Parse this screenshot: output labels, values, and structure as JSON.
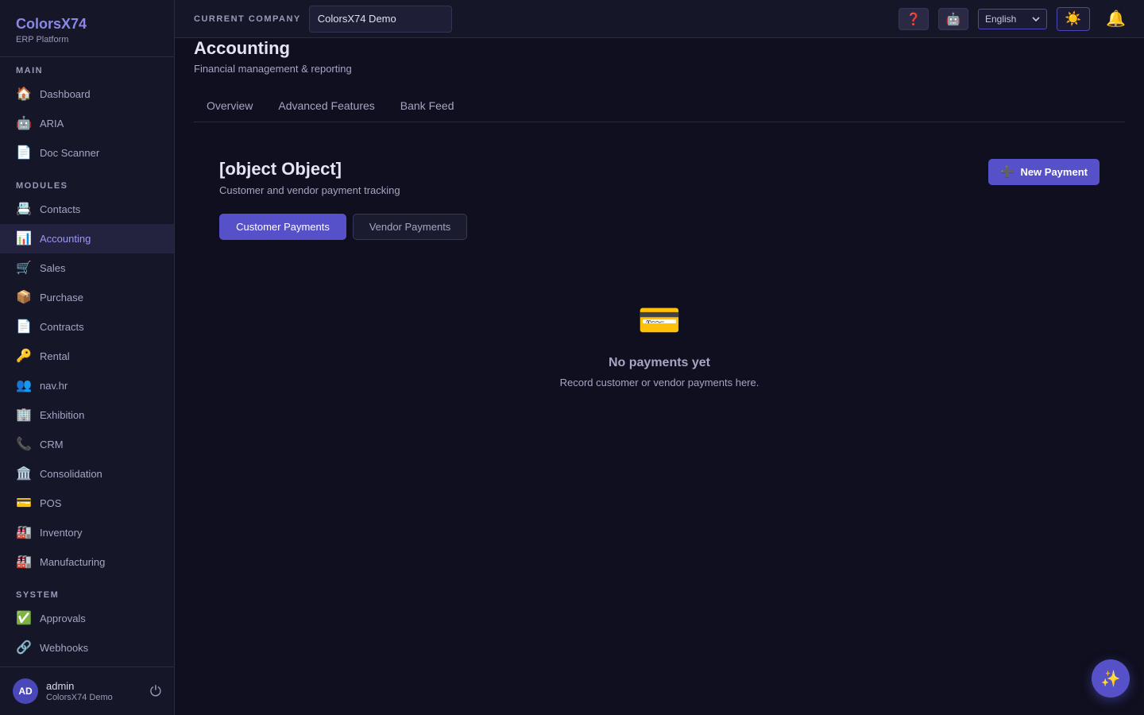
{
  "brand": {
    "name": "ColorsX74",
    "subtitle": "ERP Platform"
  },
  "sidebar": {
    "sections": [
      {
        "label": "MAIN",
        "items": [
          {
            "label": "Dashboard",
            "icon": "🏠",
            "icon_name": "home-icon"
          },
          {
            "label": "ARIA",
            "icon": "🤖",
            "icon_name": "robot-icon"
          },
          {
            "label": "Doc Scanner",
            "icon": "📄",
            "icon_name": "document-icon"
          }
        ]
      },
      {
        "label": "MODULES",
        "items": [
          {
            "label": "Contacts",
            "icon": "📇",
            "icon_name": "card-index-icon"
          },
          {
            "label": "Accounting",
            "icon": "📊",
            "icon_name": "bar-chart-icon",
            "active": true
          },
          {
            "label": "Sales",
            "icon": "🛒",
            "icon_name": "cart-icon"
          },
          {
            "label": "Purchase",
            "icon": "📦",
            "icon_name": "package-icon"
          },
          {
            "label": "Contracts",
            "icon": "📄",
            "icon_name": "document-icon"
          },
          {
            "label": "Rental",
            "icon": "🔑",
            "icon_name": "key-icon"
          },
          {
            "label": "nav.hr",
            "icon": "👥",
            "icon_name": "people-icon"
          },
          {
            "label": "Exhibition",
            "icon": "🏢",
            "icon_name": "building-icon"
          },
          {
            "label": "CRM",
            "icon": "📞",
            "icon_name": "phone-icon"
          },
          {
            "label": "Consolidation",
            "icon": "🏛️",
            "icon_name": "bank-icon"
          },
          {
            "label": "POS",
            "icon": "💳",
            "icon_name": "credit-card-icon"
          },
          {
            "label": "Inventory",
            "icon": "🏭",
            "icon_name": "factory-icon"
          },
          {
            "label": "Manufacturing",
            "icon": "🏭",
            "icon_name": "factory-icon"
          }
        ]
      },
      {
        "label": "SYSTEM",
        "items": [
          {
            "label": "Approvals",
            "icon": "✅",
            "icon_name": "check-icon"
          },
          {
            "label": "Webhooks",
            "icon": "🔗",
            "icon_name": "link-icon"
          }
        ]
      }
    ],
    "user": {
      "initials": "AD",
      "name": "admin",
      "company": "ColorsX74 Demo",
      "logout_icon": "⏻"
    }
  },
  "topbar": {
    "company_label": "CURRENT COMPANY",
    "company_value": "ColorsX74 Demo",
    "help_icon": "❓",
    "bot_icon": "🤖",
    "language": "English",
    "theme_icon": "☀️",
    "bell_icon": "🔔"
  },
  "page": {
    "title": "Accounting",
    "subtitle": "Financial management & reporting",
    "tabs": [
      "Overview",
      "Advanced Features",
      "Bank Feed"
    ]
  },
  "payments": {
    "title": "[object Object]",
    "subtitle": "Customer and vendor payment tracking",
    "new_button": "New Payment",
    "new_icon": "➕",
    "segments": {
      "customer": "Customer Payments",
      "vendor": "Vendor Payments"
    },
    "empty": {
      "icon": "💳",
      "title": "No payments yet",
      "subtitle": "Record customer or vendor payments here."
    }
  },
  "fab_icon": "✨",
  "colors": {
    "accent": "#5651c8",
    "background": "#0f0f1f",
    "sidebar": "#161629"
  }
}
